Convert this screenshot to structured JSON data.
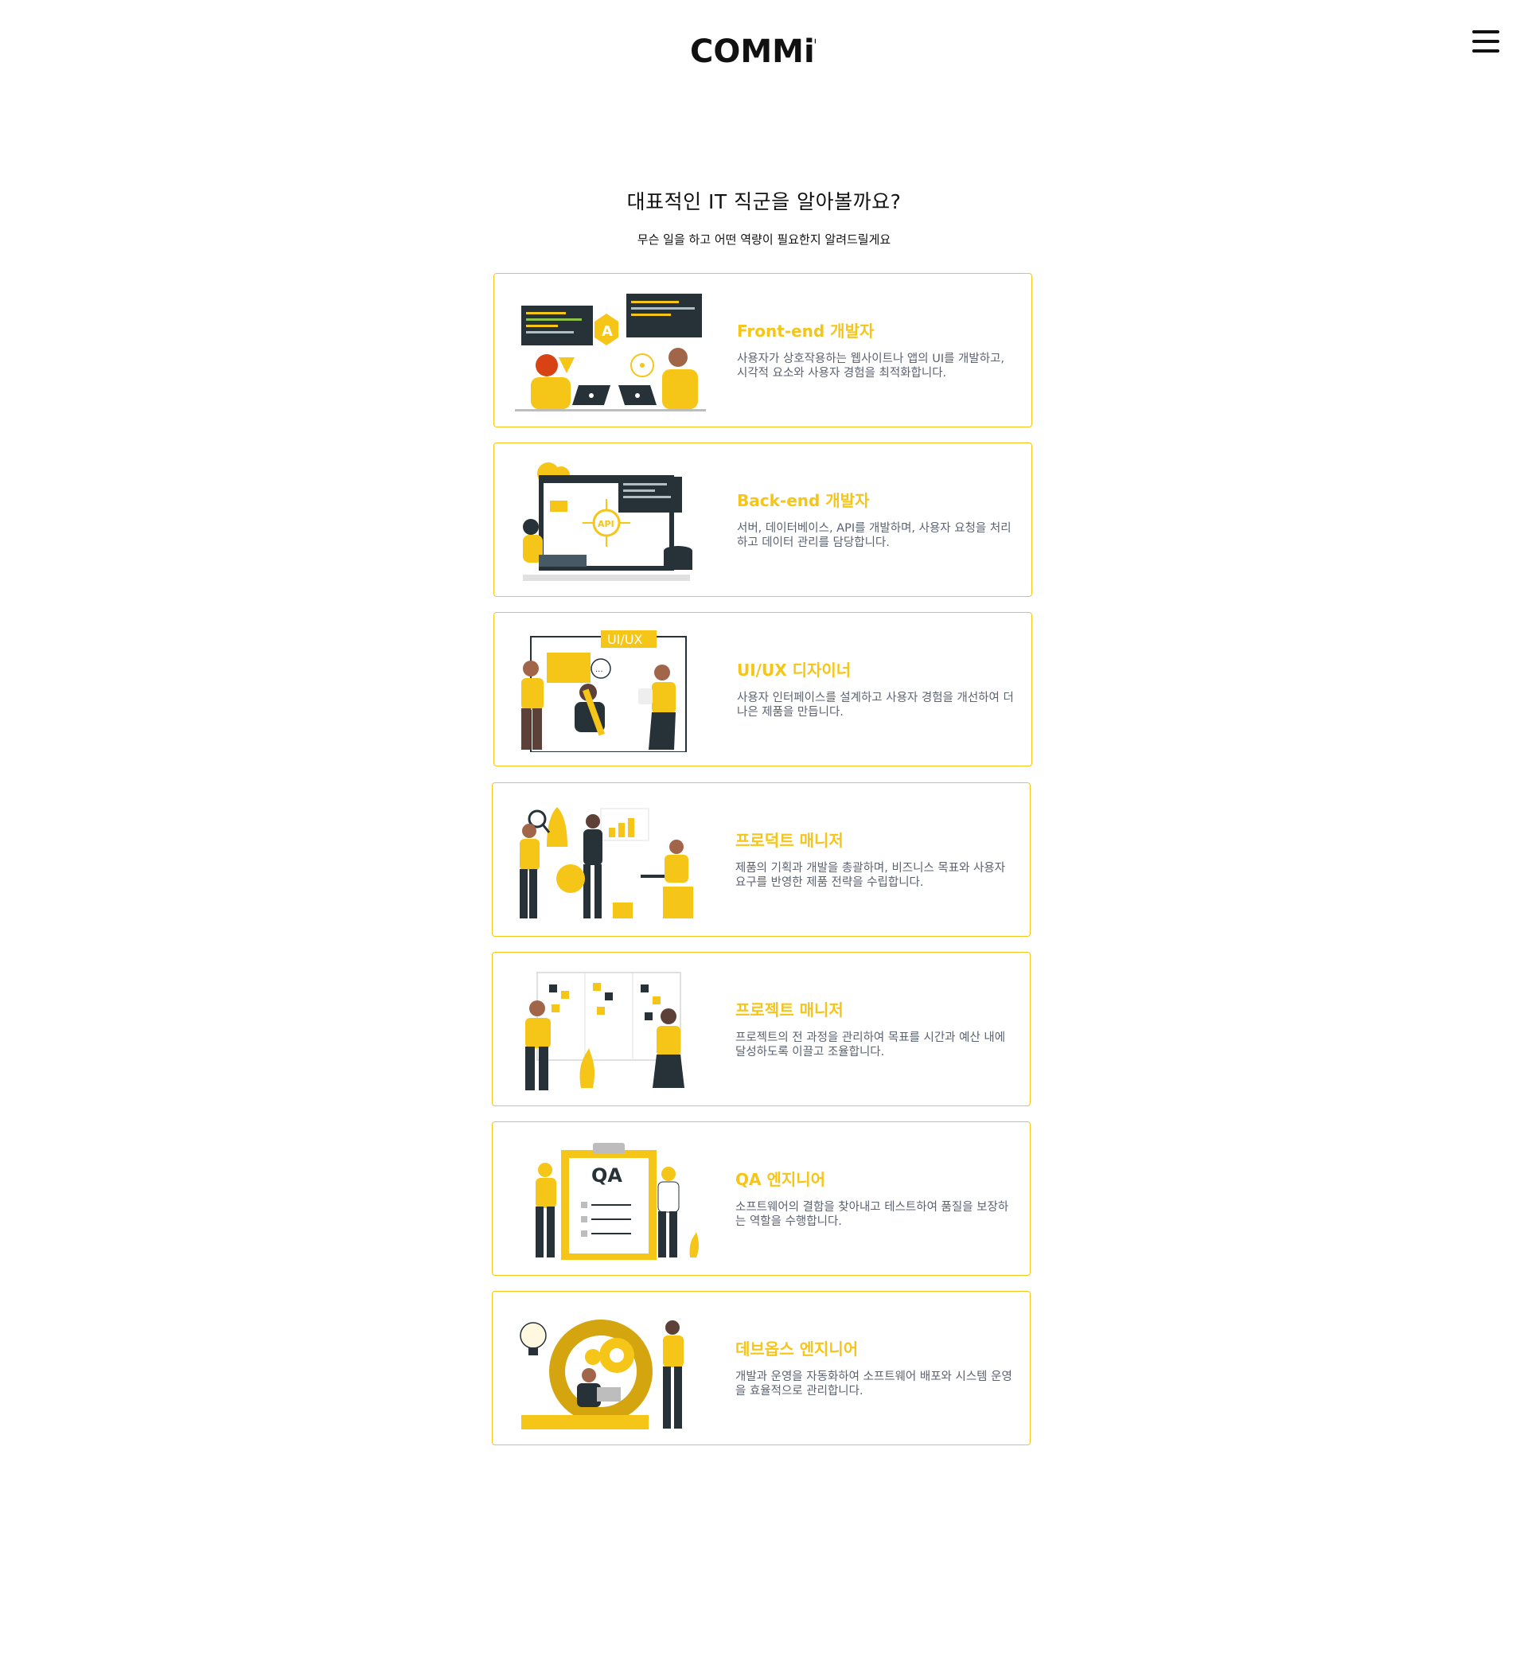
{
  "header": {
    "logo_text": "COMMiT",
    "menu_icon": "hamburger-icon"
  },
  "intro": {
    "title": "대표적인 IT 직군을 알아볼까요?",
    "subtitle": "무슨 일을 하고 어떤 역량이 필요한지 알려드릴게요"
  },
  "colors": {
    "accent": "#f5c518",
    "dark": "#263238",
    "desc": "#5b6270"
  },
  "jobs": [
    {
      "title": "Front-end 개발자",
      "description": "사용자가 상호작용하는 웹사이트나 앱의 UI를 개발하고, 시각적 요소와 사용자 경험을 최적화합니다."
    },
    {
      "title": "Back-end 개발자",
      "description": "서버, 데이터베이스, API를 개발하며, 사용자 요청을 처리하고 데이터 관리를 담당합니다."
    },
    {
      "title": "UI/UX 디자이너",
      "description": "사용자 인터페이스를 설계하고 사용자 경험을 개선하여 더 나은 제품을 만듭니다.",
      "illustration_label": "UI/UX"
    },
    {
      "title": "프로덕트 매니저",
      "description": "제품의 기획과 개발을 총괄하며, 비즈니스 목표와 사용자 요구를 반영한 제품 전략을 수립합니다."
    },
    {
      "title": "프로젝트 매니저",
      "description": "프로젝트의 전 과정을 관리하여 목표를 시간과 예산 내에 달성하도록 이끌고 조율합니다."
    },
    {
      "title": "QA 엔지니어",
      "description": "소프트웨어의 결함을 찾아내고 테스트하여 품질을 보장하는 역할을 수행합니다.",
      "illustration_label": "QA"
    },
    {
      "title": "데브옵스 엔지니어",
      "description": "개발과 운영을 자동화하여 소프트웨어 배포와 시스템 운영을 효율적으로 관리합니다."
    }
  ]
}
